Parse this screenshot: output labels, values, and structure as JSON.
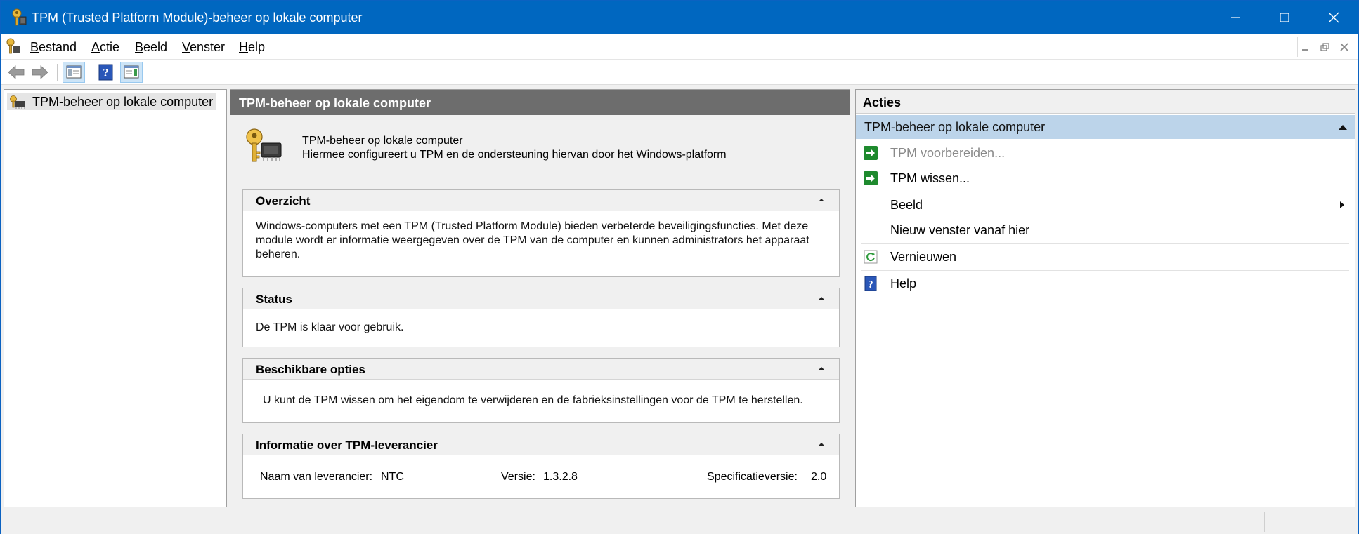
{
  "window": {
    "title": "TPM (Trusted Platform Module)-beheer op lokale computer"
  },
  "menu": {
    "items": [
      {
        "label": "Bestand",
        "underline": "B",
        "rest": "estand"
      },
      {
        "label": "Actie",
        "underline": "A",
        "rest": "ctie"
      },
      {
        "label": "Beeld",
        "underline": "B",
        "rest": "eeld"
      },
      {
        "label": "Venster",
        "underline": "V",
        "rest": "enster"
      },
      {
        "label": "Help",
        "underline": "H",
        "rest": "elp"
      }
    ]
  },
  "tree": {
    "root_label": "TPM-beheer op lokale computer"
  },
  "center": {
    "header": "TPM-beheer op lokale computer",
    "intro_title": "TPM-beheer op lokale computer",
    "intro_desc": "Hiermee configureert u TPM en de ondersteuning hiervan door het Windows-platform",
    "sections": {
      "overview": {
        "title": "Overzicht",
        "body": "Windows-computers met een TPM (Trusted Platform Module) bieden verbeterde beveiligingsfuncties. Met deze module wordt er informatie weergegeven over de TPM van de computer en kunnen administrators het apparaat beheren."
      },
      "status": {
        "title": "Status",
        "body": "De TPM is klaar voor gebruik."
      },
      "options": {
        "title": "Beschikbare opties",
        "body": "U kunt de TPM wissen om het eigendom te verwijderen en de fabrieksinstellingen voor de TPM te herstellen."
      },
      "vendor": {
        "title": "Informatie over TPM-leverancier",
        "name_label": "Naam van leverancier:",
        "name_value": "NTC",
        "version_label": "Versie:",
        "version_value": "1.3.2.8",
        "spec_label": "Specificatieversie:",
        "spec_value": "2.0"
      }
    }
  },
  "actions": {
    "header": "Acties",
    "group": "TPM-beheer op lokale computer",
    "items": [
      {
        "label": "TPM voorbereiden...",
        "icon": "green-arrow-icon",
        "disabled": true
      },
      {
        "label": "TPM wissen...",
        "icon": "green-arrow-icon",
        "disabled": false
      },
      {
        "label": "Beeld",
        "icon": "",
        "submenu": true
      },
      {
        "label": "Nieuw venster vanaf hier",
        "icon": ""
      },
      {
        "label": "Vernieuwen",
        "icon": "refresh-icon"
      },
      {
        "label": "Help",
        "icon": "help-icon"
      }
    ]
  },
  "colors": {
    "titlebar": "#0067c0",
    "center_header": "#6d6d6d",
    "actions_group": "#bcd4ea",
    "action_green": "#1e8a2e"
  }
}
